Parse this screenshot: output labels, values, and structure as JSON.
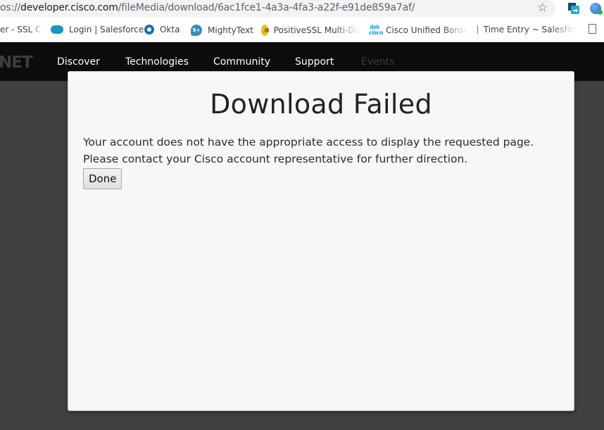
{
  "browser": {
    "url_prefix": "os://",
    "url_host": "developer.cisco.com",
    "url_path": "/fileMedia/download/6ac1fce1-4a3a-4fa3-a22f-e91de859a7af/",
    "bookmarks": [
      {
        "label": "er - SSL Ce",
        "icon": "none"
      },
      {
        "label": "Login | Salesforce",
        "icon": "salesforce-cloud-icon"
      },
      {
        "label": "Okta",
        "icon": "okta-icon"
      },
      {
        "label": "MightyText",
        "icon": "mightytext-icon"
      },
      {
        "label": "PositiveSSL Multi-Do",
        "icon": "lock-badge-icon"
      },
      {
        "label": "Cisco Unified Border",
        "icon": "cisco-icon"
      },
      {
        "label": "Time Entry ~ Salesfor",
        "icon": "salesforce-cloud-icon"
      },
      {
        "label": "",
        "icon": "document-icon"
      }
    ],
    "mighty_badge": "9+"
  },
  "site": {
    "logo_text": "NET",
    "nav": [
      {
        "label": "Discover"
      },
      {
        "label": "Technologies"
      },
      {
        "label": "Community"
      },
      {
        "label": "Support"
      },
      {
        "label": "Events"
      }
    ]
  },
  "modal": {
    "title": "Download Failed",
    "message": "Your account does not have the appropriate access to display the requested page. Please contact your Cisco account representative for further direction.",
    "done_label": "Done"
  }
}
